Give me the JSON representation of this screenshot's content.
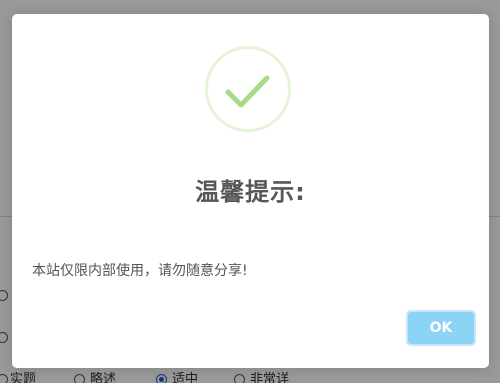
{
  "dialog": {
    "title": "温馨提示:",
    "message": "本站仅限内部使用，请勿随意分享!",
    "ok_label": "OK",
    "icon": "success-check-icon",
    "colors": {
      "check": "#a5dc86",
      "ring": "#e4f5d7",
      "ok_button": "#8cd4f5"
    }
  },
  "background": {
    "radio_options": [
      {
        "label": "实题",
        "checked": false
      },
      {
        "label": "略述",
        "checked": false
      },
      {
        "label": "适中",
        "checked": true
      },
      {
        "label": "非常详",
        "checked": false
      }
    ]
  }
}
